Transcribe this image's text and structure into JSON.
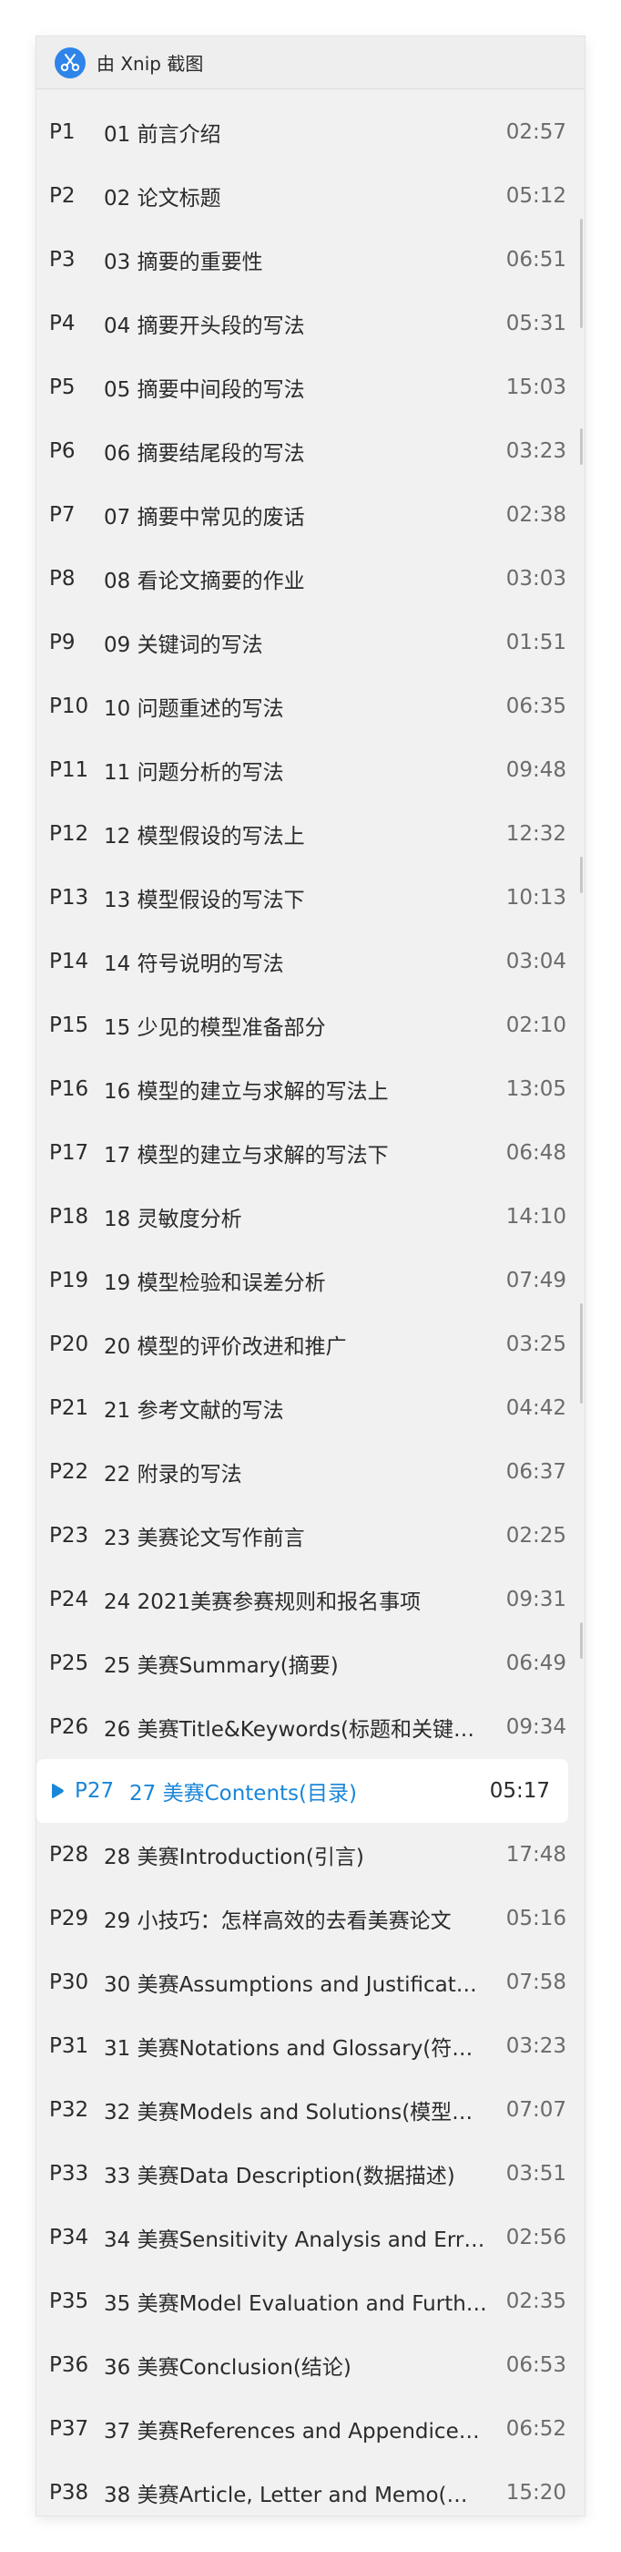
{
  "window": {
    "title": "由 Xnip 截图"
  },
  "playlist": [
    {
      "p": "P1",
      "title": "01 前言介绍",
      "duration": "02:57"
    },
    {
      "p": "P2",
      "title": "02 论文标题",
      "duration": "05:12"
    },
    {
      "p": "P3",
      "title": "03 摘要的重要性",
      "duration": "06:51"
    },
    {
      "p": "P4",
      "title": "04 摘要开头段的写法",
      "duration": "05:31"
    },
    {
      "p": "P5",
      "title": "05 摘要中间段的写法",
      "duration": "15:03"
    },
    {
      "p": "P6",
      "title": "06 摘要结尾段的写法",
      "duration": "03:23"
    },
    {
      "p": "P7",
      "title": "07 摘要中常见的废话",
      "duration": "02:38"
    },
    {
      "p": "P8",
      "title": "08 看论文摘要的作业",
      "duration": "03:03"
    },
    {
      "p": "P9",
      "title": "09 关键词的写法",
      "duration": "01:51"
    },
    {
      "p": "P10",
      "title": "10 问题重述的写法",
      "duration": "06:35"
    },
    {
      "p": "P11",
      "title": "11 问题分析的写法",
      "duration": "09:48"
    },
    {
      "p": "P12",
      "title": "12 模型假设的写法上",
      "duration": "12:32"
    },
    {
      "p": "P13",
      "title": "13 模型假设的写法下",
      "duration": "10:13"
    },
    {
      "p": "P14",
      "title": "14 符号说明的写法",
      "duration": "03:04"
    },
    {
      "p": "P15",
      "title": "15 少见的模型准备部分",
      "duration": "02:10"
    },
    {
      "p": "P16",
      "title": "16 模型的建立与求解的写法上",
      "duration": "13:05"
    },
    {
      "p": "P17",
      "title": "17 模型的建立与求解的写法下",
      "duration": "06:48"
    },
    {
      "p": "P18",
      "title": "18 灵敏度分析",
      "duration": "14:10"
    },
    {
      "p": "P19",
      "title": "19 模型检验和误差分析",
      "duration": "07:49"
    },
    {
      "p": "P20",
      "title": "20 模型的评价改进和推广",
      "duration": "03:25"
    },
    {
      "p": "P21",
      "title": "21 参考文献的写法",
      "duration": "04:42"
    },
    {
      "p": "P22",
      "title": "22 附录的写法",
      "duration": "06:37"
    },
    {
      "p": "P23",
      "title": "23 美赛论文写作前言",
      "duration": "02:25"
    },
    {
      "p": "P24",
      "title": "24 2021美赛参赛规则和报名事项",
      "duration": "09:31"
    },
    {
      "p": "P25",
      "title": "25 美赛Summary(摘要)",
      "duration": "06:49"
    },
    {
      "p": "P26",
      "title": "26 美赛Title&Keywords(标题和关键…",
      "duration": "09:34"
    },
    {
      "p": "P27",
      "title": "27 美赛Contents(目录)",
      "duration": "05:17",
      "active": true
    },
    {
      "p": "P28",
      "title": "28 美赛Introduction(引言)",
      "duration": "17:48"
    },
    {
      "p": "P29",
      "title": "29 小技巧：怎样高效的去看美赛论文",
      "duration": "05:16"
    },
    {
      "p": "P30",
      "title": "30 美赛Assumptions and Justificat…",
      "duration": "07:58"
    },
    {
      "p": "P31",
      "title": "31 美赛Notations and Glossary(符…",
      "duration": "03:23"
    },
    {
      "p": "P32",
      "title": "32 美赛Models and Solutions(模型…",
      "duration": "07:07"
    },
    {
      "p": "P33",
      "title": "33 美赛Data Description(数据描述)",
      "duration": "03:51"
    },
    {
      "p": "P34",
      "title": "34 美赛Sensitivity Analysis and Err…",
      "duration": "02:56"
    },
    {
      "p": "P35",
      "title": "35 美赛Model Evaluation and Furth…",
      "duration": "02:35"
    },
    {
      "p": "P36",
      "title": "36 美赛Conclusion(结论)",
      "duration": "06:53"
    },
    {
      "p": "P37",
      "title": "37 美赛References and Appendice…",
      "duration": "06:52"
    },
    {
      "p": "P38",
      "title": "38 美赛Article, Letter and Memo(…",
      "duration": "15:20"
    }
  ],
  "colors": {
    "accent": "#1a86d8",
    "panel_bg": "#f1f1f1",
    "app_icon_bg": "#2f84ea"
  },
  "icons": {
    "app": "xnip-app-icon",
    "playing": "playing-indicator-icon"
  }
}
